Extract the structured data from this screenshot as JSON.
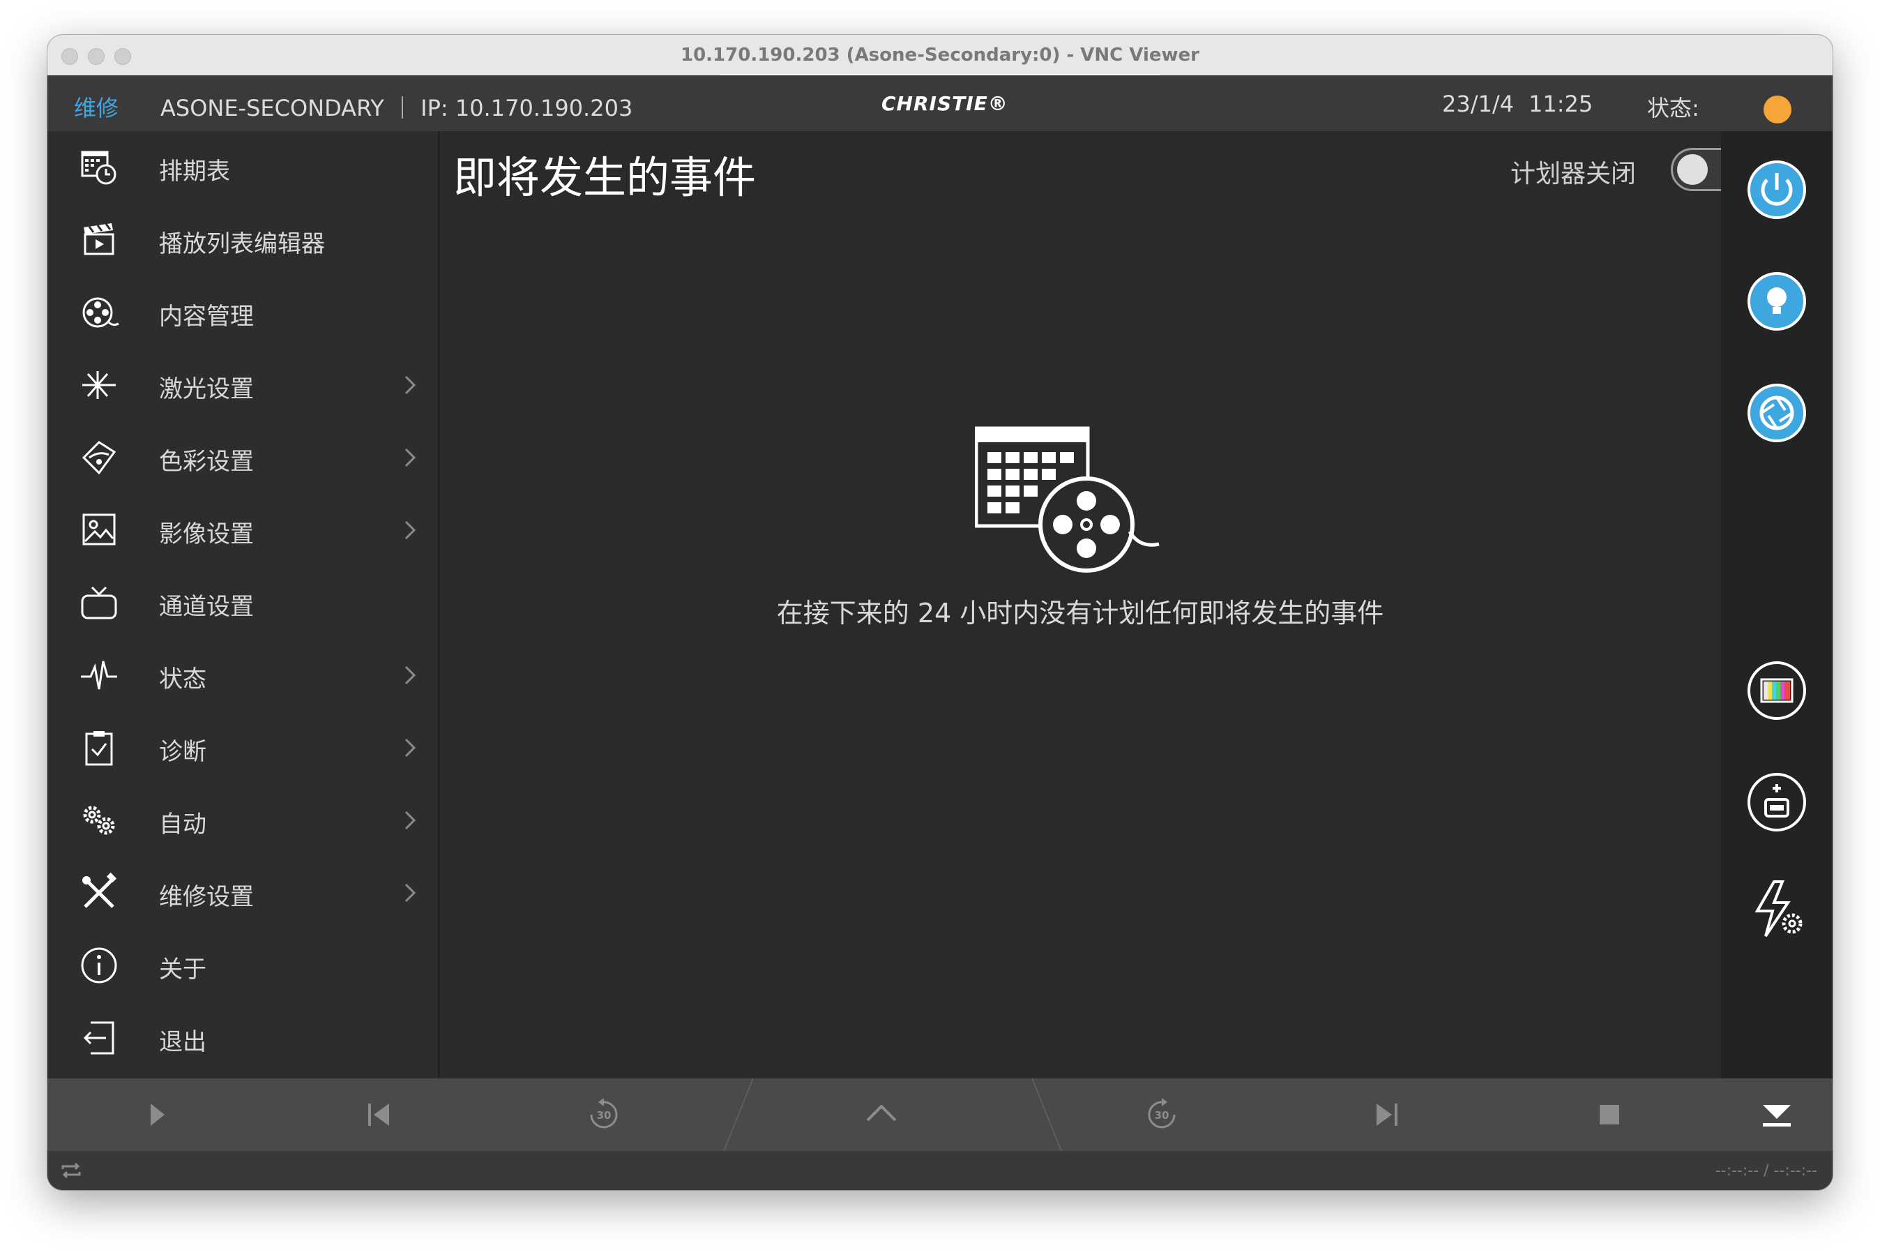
{
  "window": {
    "title": "10.170.190.203 (Asone-Secondary:0) - VNC Viewer"
  },
  "header": {
    "mode": "维修",
    "device": "ASONE-SECONDARY ｜ IP: 10.170.190.203",
    "brand": "CHRISTIE®",
    "date": "23/1/4",
    "time": "11:25",
    "status_label": "状态:",
    "status_color": "#f5a637"
  },
  "sidebar": {
    "items": [
      {
        "label": "排期表",
        "icon": "schedule-clock-icon",
        "has_submenu": false
      },
      {
        "label": "播放列表编辑器",
        "icon": "clapperboard-icon",
        "has_submenu": false
      },
      {
        "label": "内容管理",
        "icon": "film-reel-icon",
        "has_submenu": false
      },
      {
        "label": "激光设置",
        "icon": "laser-icon",
        "has_submenu": true
      },
      {
        "label": "色彩设置",
        "icon": "color-tag-icon",
        "has_submenu": true
      },
      {
        "label": "影像设置",
        "icon": "image-icon",
        "has_submenu": true
      },
      {
        "label": "通道设置",
        "icon": "tv-icon",
        "has_submenu": false
      },
      {
        "label": "状态",
        "icon": "pulse-icon",
        "has_submenu": true
      },
      {
        "label": "诊断",
        "icon": "clipboard-check-icon",
        "has_submenu": true
      },
      {
        "label": "自动",
        "icon": "gears-icon",
        "has_submenu": true
      },
      {
        "label": "维修设置",
        "icon": "tools-icon",
        "has_submenu": true
      },
      {
        "label": "关于",
        "icon": "info-icon",
        "has_submenu": false
      },
      {
        "label": "退出",
        "icon": "logout-icon",
        "has_submenu": false
      }
    ]
  },
  "main": {
    "title": "即将发生的事件",
    "scheduler_label": "计划器关闭",
    "scheduler_enabled": false,
    "empty_message": "在接下来的 24 小时内没有计划任何即将发生的事件"
  },
  "rightbar": {
    "buttons": [
      "power-icon",
      "lamp-icon",
      "shutter-icon",
      "test-pattern-icon",
      "ingest-icon",
      "power-settings-icon"
    ],
    "accent": "#3fa7e0"
  },
  "transport": {
    "buttons": [
      "play-icon",
      "skip-back-icon",
      "rewind-30-icon",
      "expand-up-icon",
      "forward-30-icon",
      "skip-forward-icon",
      "stop-icon",
      "eject-icon"
    ],
    "rewind_label": "30",
    "forward_label": "30"
  },
  "statusbar": {
    "timecode": "--:--:-- / --:--:--"
  }
}
